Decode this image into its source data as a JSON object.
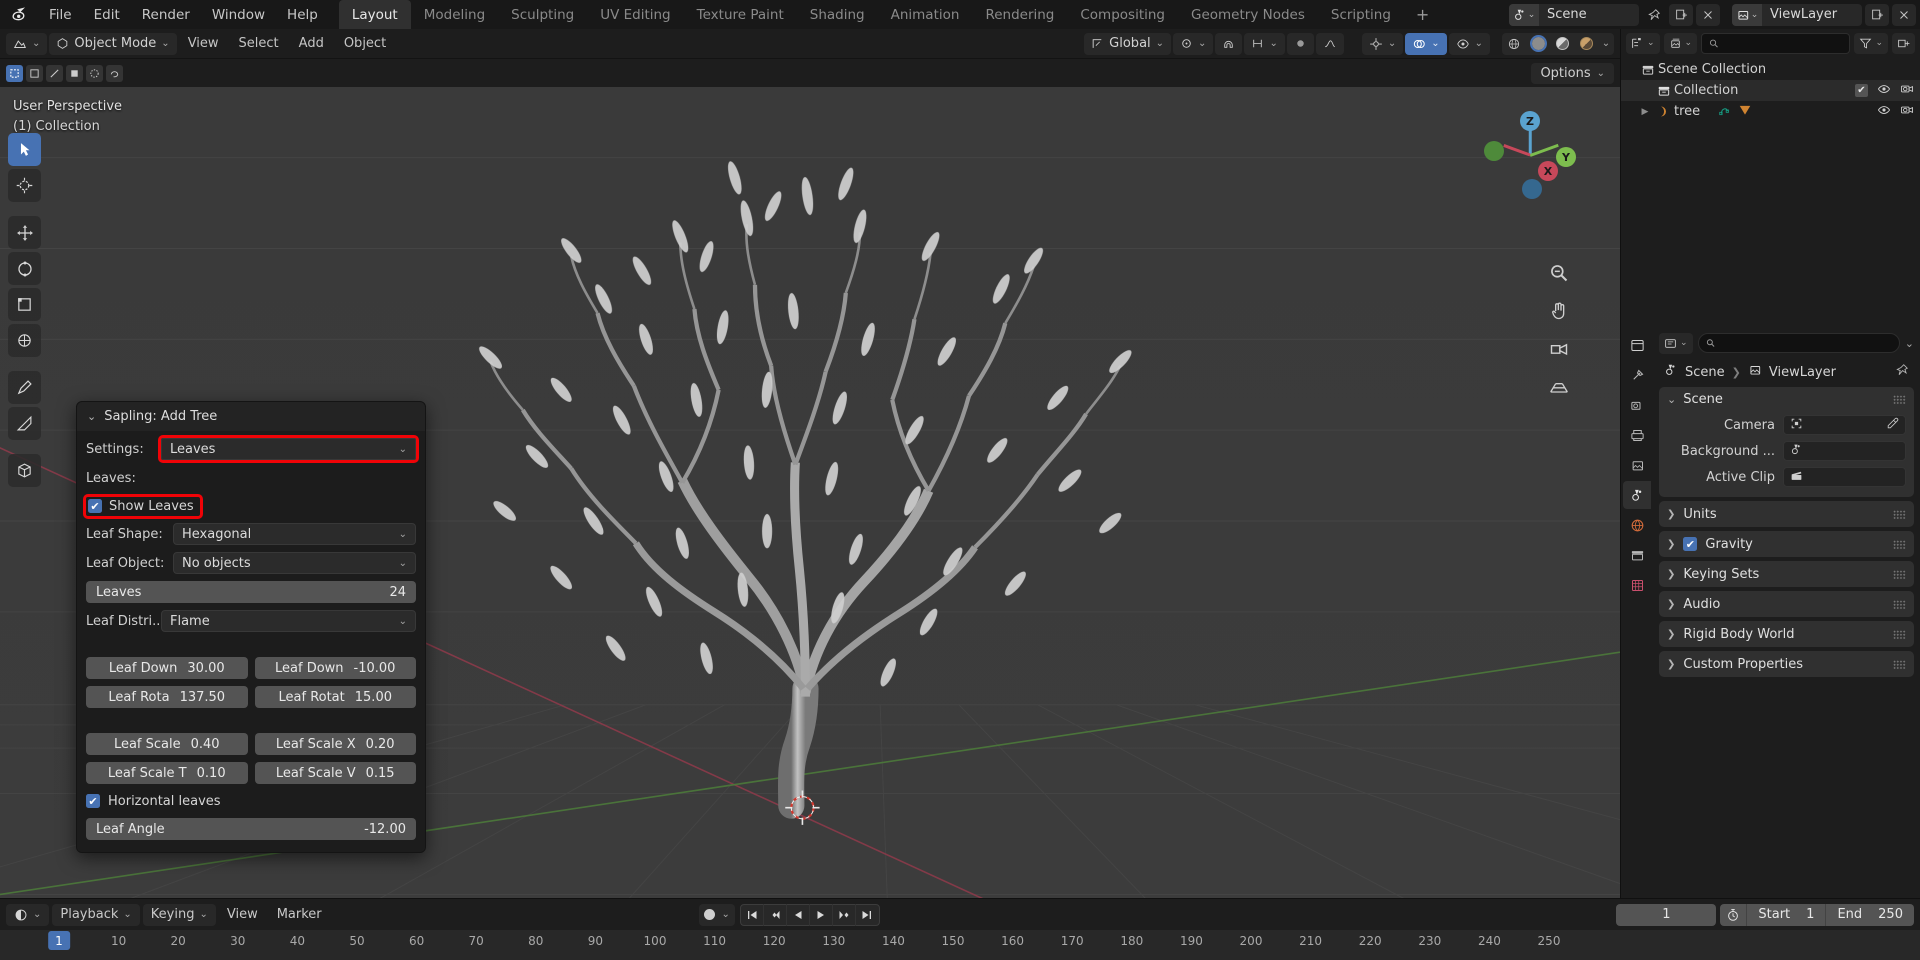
{
  "topbar": {
    "logo_icon": "blender-logo-icon",
    "menus": [
      "File",
      "Edit",
      "Render",
      "Window",
      "Help"
    ],
    "workspaces": [
      {
        "label": "Layout",
        "active": true
      },
      {
        "label": "Modeling",
        "active": false
      },
      {
        "label": "Sculpting",
        "active": false
      },
      {
        "label": "UV Editing",
        "active": false
      },
      {
        "label": "Texture Paint",
        "active": false
      },
      {
        "label": "Shading",
        "active": false
      },
      {
        "label": "Animation",
        "active": false
      },
      {
        "label": "Rendering",
        "active": false
      },
      {
        "label": "Compositing",
        "active": false
      },
      {
        "label": "Geometry Nodes",
        "active": false
      },
      {
        "label": "Scripting",
        "active": false
      }
    ],
    "add_workspace_label": "+",
    "scene_name": "Scene",
    "view_layer_name": "ViewLayer"
  },
  "viewport_header": {
    "mode": "Object Mode",
    "menus": [
      "View",
      "Select",
      "Add",
      "Object"
    ],
    "transform_orientation": "Global",
    "options_label": "Options"
  },
  "viewport": {
    "perspective_label": "User Perspective",
    "collection_label": "(1) Collection",
    "gizmo_axes": [
      "X",
      "Y",
      "Z"
    ]
  },
  "sapling": {
    "title": "Sapling: Add Tree",
    "settings_label": "Settings:",
    "settings_value": "Leaves",
    "section_label": "Leaves:",
    "show_leaves_label": "Show Leaves",
    "show_leaves_checked": true,
    "leaf_shape_label": "Leaf Shape:",
    "leaf_shape_value": "Hexagonal",
    "leaf_object_label": "Leaf Object:",
    "leaf_object_value": "No objects",
    "leaves_slider_label": "Leaves",
    "leaves_slider_value": "24",
    "leaf_distri_label": "Leaf Distri...",
    "leaf_distri_value": "Flame",
    "buttons": [
      [
        {
          "label": "Leaf Down",
          "value": "30.00"
        },
        {
          "label": "Leaf Down",
          "value": "-10.00"
        }
      ],
      [
        {
          "label": "Leaf Rota",
          "value": "137.50"
        },
        {
          "label": "Leaf Rotat",
          "value": "15.00"
        }
      ],
      [
        {
          "label": "Leaf Scale",
          "value": "0.40"
        },
        {
          "label": "Leaf Scale X",
          "value": "0.20"
        }
      ],
      [
        {
          "label": "Leaf Scale T",
          "value": "0.10"
        },
        {
          "label": "Leaf Scale V",
          "value": "0.15"
        }
      ]
    ],
    "horizontal_leaves_label": "Horizontal leaves",
    "horizontal_leaves_checked": true,
    "leaf_angle_label": "Leaf Angle",
    "leaf_angle_value": "-12.00",
    "highlight_color": "#f00307"
  },
  "outliner": {
    "search_placeholder": "",
    "rows": [
      {
        "label": "Scene Collection",
        "indent": 0,
        "icon": "collection-icon",
        "has_tri": false,
        "selected": false,
        "checkbox": false,
        "eye": false,
        "camera": false
      },
      {
        "label": "Collection",
        "indent": 1,
        "icon": "collection-icon",
        "has_tri": false,
        "selected": true,
        "checkbox": true,
        "eye": true,
        "camera": true
      },
      {
        "label": "tree",
        "indent": 1,
        "icon": "mesh-data-icon",
        "has_tri": true,
        "selected": false,
        "checkbox": false,
        "eye": true,
        "camera": true
      }
    ]
  },
  "properties": {
    "search_placeholder": "",
    "breadcrumb": [
      "Scene",
      "ViewLayer"
    ],
    "scene_panel": {
      "title": "Scene",
      "rows": [
        {
          "label": "Camera",
          "icon": "camera-data-icon",
          "eyedropper": true
        },
        {
          "label": "Background ...",
          "icon": "scene-icon",
          "eyedropper": false
        },
        {
          "label": "Active Clip",
          "icon": "clip-icon",
          "eyedropper": false
        }
      ]
    },
    "closed_panels": [
      {
        "label": "Units",
        "checkbox": false
      },
      {
        "label": "Gravity",
        "checkbox": true
      },
      {
        "label": "Keying Sets",
        "checkbox": false
      },
      {
        "label": "Audio",
        "checkbox": false
      },
      {
        "label": "Rigid Body World",
        "checkbox": false
      },
      {
        "label": "Custom Properties",
        "checkbox": false
      }
    ]
  },
  "timeline": {
    "menus": [
      "Playback",
      "Keying",
      "View",
      "Marker"
    ],
    "current_frame": "1",
    "start_label": "Start",
    "start_value": "1",
    "end_label": "End",
    "end_value": "250",
    "playhead_frame": "1",
    "ticks": [
      "10",
      "20",
      "30",
      "40",
      "50",
      "60",
      "70",
      "80",
      "90",
      "100",
      "110",
      "120",
      "130",
      "140",
      "150",
      "160",
      "170",
      "180",
      "190",
      "200",
      "210",
      "220",
      "230",
      "240",
      "250"
    ]
  }
}
